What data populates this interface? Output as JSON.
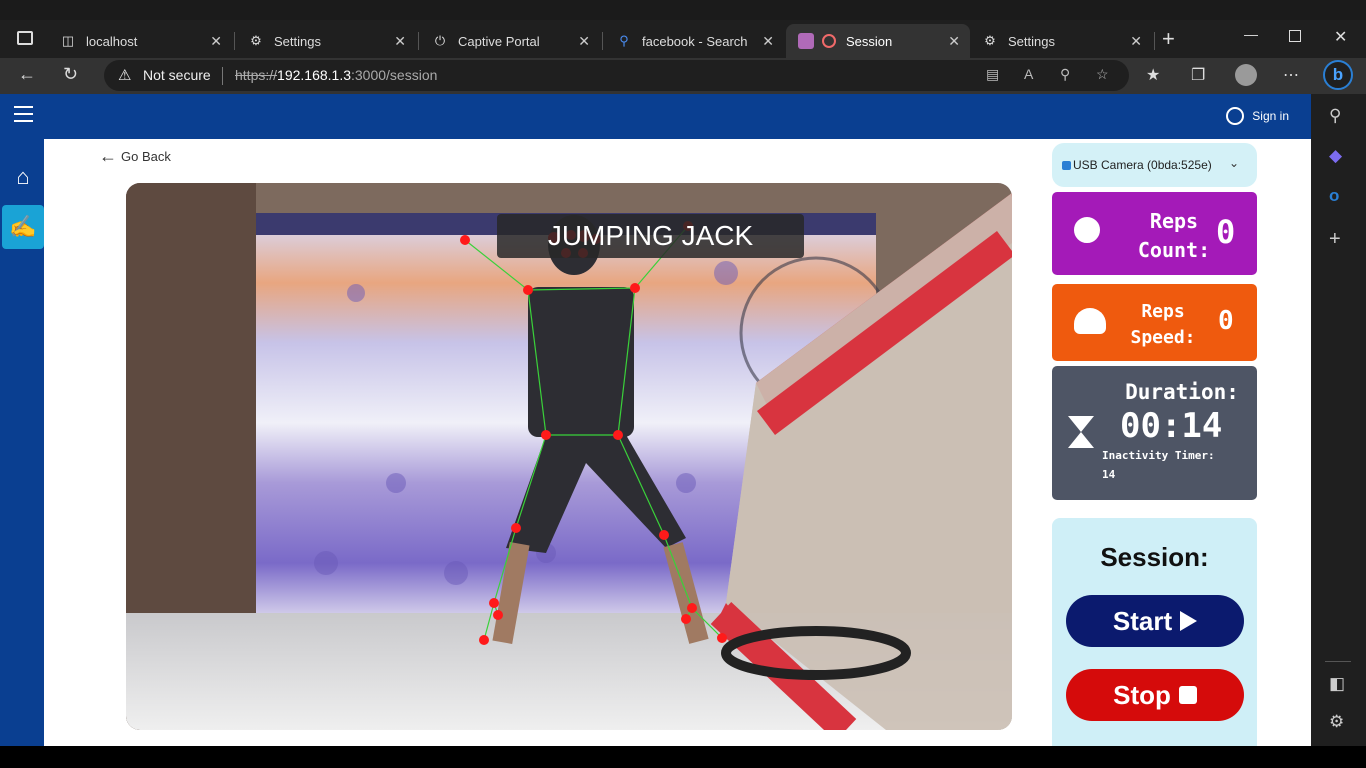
{
  "browser": {
    "tabs": [
      {
        "label": "localhost",
        "icon": "page-icon"
      },
      {
        "label": "Settings",
        "icon": "gear-icon"
      },
      {
        "label": "Captive Portal",
        "icon": "power-icon"
      },
      {
        "label": "facebook - Search",
        "icon": "search-icon"
      },
      {
        "label": "Session",
        "icon": "record-icon",
        "active": true
      },
      {
        "label": "Settings",
        "icon": "gear-icon"
      }
    ],
    "security": "Not secure",
    "url_scheme": "https://",
    "url_host": "192.168.1.3",
    "url_path": ":3000/session"
  },
  "app": {
    "signin_label": "Sign in",
    "goback_label": "Go Back",
    "exercise": "JUMPING JACK",
    "camera": "USB Camera (0bda:525e)",
    "reps": {
      "label_line1": "Reps",
      "label_line2": "Count:",
      "value": "0",
      "color": "#a41ab8"
    },
    "speed": {
      "label_line1": "Reps",
      "label_line2": "Speed:",
      "value": "0",
      "color": "#ef5a0e"
    },
    "duration": {
      "label": "Duration:",
      "value": "00:14",
      "inactivity_label": "Inactivity Timer:",
      "inactivity_value": "14",
      "color": "#4e5565"
    },
    "session": {
      "title": "Session:",
      "start_label": "Start",
      "stop_label": "Stop"
    }
  }
}
